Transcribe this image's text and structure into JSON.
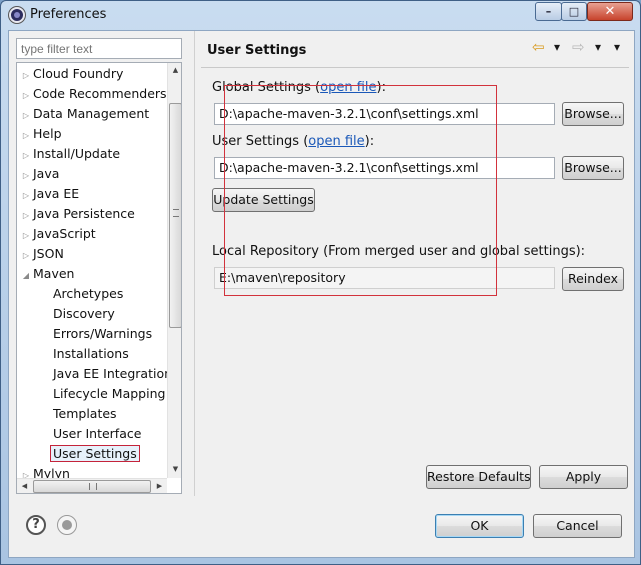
{
  "window": {
    "title": "Preferences",
    "controls": {
      "minimize": "–",
      "maximize": "□",
      "close": "✕"
    }
  },
  "filter": {
    "placeholder": "type filter text"
  },
  "tree": {
    "items": [
      {
        "label": "Cloud Foundry",
        "arrow": "▷"
      },
      {
        "label": "Code Recommenders",
        "arrow": "▷"
      },
      {
        "label": "Data Management",
        "arrow": "▷"
      },
      {
        "label": "Help",
        "arrow": "▷"
      },
      {
        "label": "Install/Update",
        "arrow": "▷"
      },
      {
        "label": "Java",
        "arrow": "▷"
      },
      {
        "label": "Java EE",
        "arrow": "▷"
      },
      {
        "label": "Java Persistence",
        "arrow": "▷"
      },
      {
        "label": "JavaScript",
        "arrow": "▷"
      },
      {
        "label": "JSON",
        "arrow": "▷"
      },
      {
        "label": "Maven",
        "arrow": "◢"
      },
      {
        "label": "Archetypes",
        "arrow": ""
      },
      {
        "label": "Discovery",
        "arrow": ""
      },
      {
        "label": "Errors/Warnings",
        "arrow": ""
      },
      {
        "label": "Installations",
        "arrow": ""
      },
      {
        "label": "Java EE Integration",
        "arrow": ""
      },
      {
        "label": "Lifecycle Mapping",
        "arrow": ""
      },
      {
        "label": "Templates",
        "arrow": ""
      },
      {
        "label": "User Interface",
        "arrow": ""
      },
      {
        "label": "User Settings",
        "arrow": ""
      },
      {
        "label": "Mylyn",
        "arrow": "▷"
      }
    ],
    "selected": "User Settings",
    "scroll_glyphs": {
      "up": "▲",
      "down": "▼",
      "left": "◀",
      "right": "▶"
    }
  },
  "page": {
    "title": "User Settings",
    "nav": {
      "back": "⇦",
      "back_menu": "▾",
      "forward": "⇨",
      "forward_menu": "▾",
      "view_menu": "▾"
    },
    "global_settings": {
      "label": "Global Settings (",
      "link": "open file",
      "label_end": "):",
      "value": "D:\\apache-maven-3.2.1\\conf\\settings.xml",
      "browse": "Browse..."
    },
    "user_settings": {
      "label": "User Settings (",
      "link": "open file",
      "label_end": "):",
      "value": "D:\\apache-maven-3.2.1\\conf\\settings.xml",
      "browse": "Browse..."
    },
    "update_button": "Update Settings",
    "local_repo": {
      "label": "Local Repository (From merged user and global settings):",
      "value": "E:\\maven\\repository",
      "reindex": "Reindex"
    },
    "restore_defaults": "Restore Defaults",
    "apply": "Apply"
  },
  "footer": {
    "ok": "OK",
    "cancel": "Cancel"
  },
  "colors": {
    "link": "#1a58b8",
    "highlight_box": "#d2323c"
  }
}
